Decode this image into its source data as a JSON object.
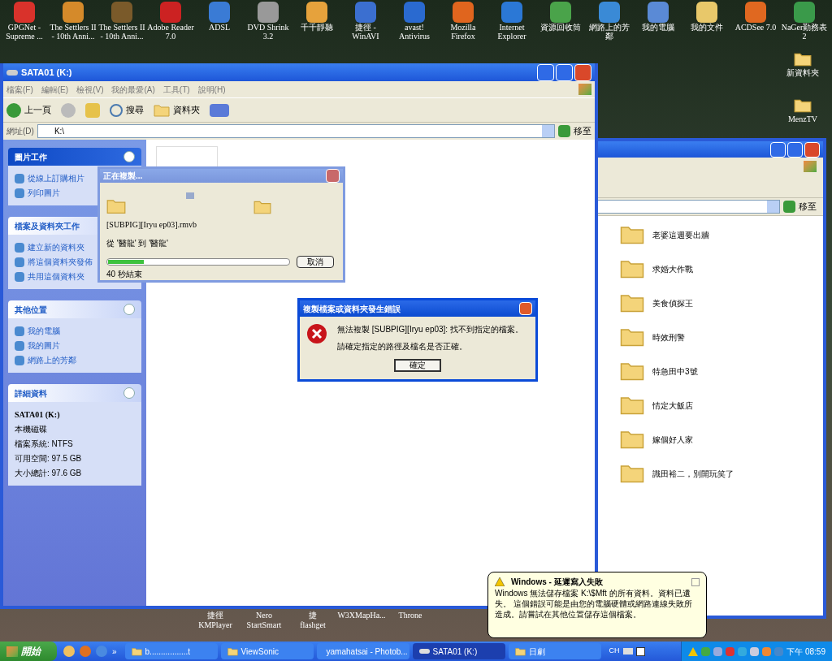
{
  "desktop_icons_top": [
    {
      "lines": [
        "GPGNet -",
        "Supreme ..."
      ]
    },
    {
      "lines": [
        "The Settlers II",
        "- 10th Anni..."
      ]
    },
    {
      "lines": [
        "The Settlers II",
        "- 10th Anni..."
      ]
    },
    {
      "lines": [
        "Adobe Reader",
        "7.0"
      ]
    },
    {
      "lines": [
        "ADSL"
      ]
    },
    {
      "lines": [
        "DVD Shrink",
        "3.2"
      ]
    },
    {
      "lines": [
        "千千靜聽"
      ]
    },
    {
      "lines": [
        "捷徑 -",
        "WinAVI"
      ]
    },
    {
      "lines": [
        "avast!",
        "Antivirus"
      ]
    },
    {
      "lines": [
        "Mozilla",
        "Firefox"
      ]
    },
    {
      "lines": [
        "Internet",
        "Explorer"
      ]
    },
    {
      "lines": [
        "資源回收筒"
      ]
    },
    {
      "lines": [
        "網路上的芳",
        "鄰"
      ]
    },
    {
      "lines": [
        "我的電腦"
      ]
    },
    {
      "lines": [
        "我的文件"
      ]
    },
    {
      "lines": [
        "ACDSee 7.0"
      ]
    },
    {
      "lines": [
        "NaGer勤務表",
        "2"
      ]
    }
  ],
  "desktop_icons_right": [
    "新資料夾",
    "MenzTV"
  ],
  "desktop_icons_bottom": [
    {
      "lines": [
        "捷徑",
        "KMPlayer"
      ]
    },
    {
      "lines": [
        "Nero",
        "StartSmart"
      ]
    },
    {
      "lines": [
        "捷",
        "flashget"
      ]
    },
    {
      "lines": [
        "W3XMapHa..."
      ]
    },
    {
      "lines": [
        "Throne"
      ]
    }
  ],
  "explorer": {
    "title": "SATA01 (K:)",
    "menu": [
      "檔案(F)",
      "編輯(E)",
      "檢視(V)",
      "我的最愛(A)",
      "工具(T)",
      "說明(H)"
    ],
    "toolbar": {
      "back": "上一頁",
      "search": "搜尋",
      "folders": "資料夾"
    },
    "address": {
      "label": "網址(D)",
      "value": "K:\\",
      "go": "移至"
    },
    "panels": [
      {
        "title": "圖片工作",
        "kind": "special",
        "items": [
          "從線上訂購相片",
          "列印圖片"
        ]
      },
      {
        "title": "檔案及資料夾工作",
        "kind": "normal",
        "items": [
          "建立新的資料夾",
          "將這個資料夾發佈",
          "共用這個資料夾"
        ]
      },
      {
        "title": "其他位置",
        "kind": "normal",
        "items": [
          "我的電腦",
          "我的圖片",
          "網路上的芳鄰"
        ]
      },
      {
        "title": "詳細資料",
        "kind": "details",
        "name": "SATA01 (K:)",
        "items": [
          "本機磁碟",
          "檔案系統: NTFS",
          "可用空間: 97.5 GB",
          "大小總計: 97.6 GB"
        ]
      }
    ]
  },
  "second_window": {
    "go": "移至",
    "folders": [
      "老婆這週要出牆",
      "求婚大作戰",
      "美食偵探王",
      "時效刑警",
      "特急田中3號",
      "情定大飯店",
      "嫁個好人家",
      "識田裕二，別開玩笑了"
    ]
  },
  "copy_dialog": {
    "title": "正在複製...",
    "file": "[SUBPIG][Iryu ep03].rmvb",
    "from_to": "從 '醫龍' 到 '醫龍'",
    "level": 0.2,
    "remaining": "40 秒結束",
    "cancel": "取消"
  },
  "error_dialog": {
    "title": "複製檔案或資料夾發生錯誤",
    "lines": [
      "無法複製 [SUBPIG][Iryu ep03]: 找不到指定的檔案。",
      "請確定指定的路徑及檔名是否正確。"
    ],
    "ok": "確定"
  },
  "balloon": {
    "title": "Windows - 延遲寫入失敗",
    "text": "Windows 無法儲存檔案 K:\\$Mft 的所有資料。資料已遺失。 這個錯誤可能是由您的電腦硬體或網路連線失敗所造成。請嘗試在其他位置儲存這個檔案。"
  },
  "taskbar": {
    "start": "開始",
    "more": "»",
    "tasks": [
      {
        "label": "b.................t",
        "kind": "folder",
        "selected": false
      },
      {
        "label": "ViewSonic",
        "kind": "folder",
        "selected": false
      },
      {
        "label": "yamahatsai - Photob...",
        "kind": "browser",
        "selected": false
      },
      {
        "label": "SATA01 (K:)",
        "kind": "drive",
        "selected": true
      },
      {
        "label": "日劇",
        "kind": "folder",
        "selected": false
      }
    ],
    "lang": "CH",
    "clock": "下午 08:59"
  }
}
